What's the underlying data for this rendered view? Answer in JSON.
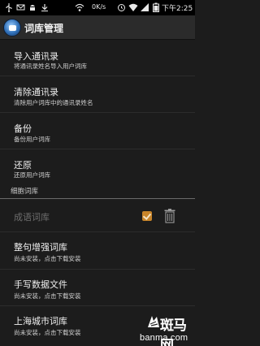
{
  "status_bar": {
    "network_speed": "0K/s",
    "time": "下午2:25",
    "colors": {
      "background": "#000000",
      "text": "#e8e8e8"
    }
  },
  "action_bar": {
    "title": "词库管理",
    "icon": "app-logo"
  },
  "items": [
    {
      "title": "导入通讯录",
      "subtitle": "将通讯录姓名导入用户词库"
    },
    {
      "title": "清除通讯录",
      "subtitle": "清除用户词库中的通讯录姓名"
    },
    {
      "title": "备份",
      "subtitle": "备份用户词库"
    },
    {
      "title": "还原",
      "subtitle": "还原用户词库"
    }
  ],
  "cell_section": {
    "header": "细胞词库",
    "installed": [
      {
        "title": "成语词库",
        "checked": true,
        "enabled": false
      }
    ],
    "available": [
      {
        "title": "整句增强词库",
        "subtitle": "尚未安装，点击下载安装"
      },
      {
        "title": "手写数据文件",
        "subtitle": "尚未安装，点击下载安装"
      },
      {
        "title": "上海城市词库",
        "subtitle": "尚未安装，点击下载安装"
      }
    ]
  },
  "watermark": {
    "brand_cn": "斑马网",
    "brand_url": "banma.com"
  },
  "colors": {
    "background": "#1c1c1c",
    "action_bar": "#2b2b2b",
    "divider": "#2c2c2c",
    "section_line": "#6a6a6a",
    "checkbox": "#c8852a",
    "disabled_text": "#6d6d6d"
  }
}
